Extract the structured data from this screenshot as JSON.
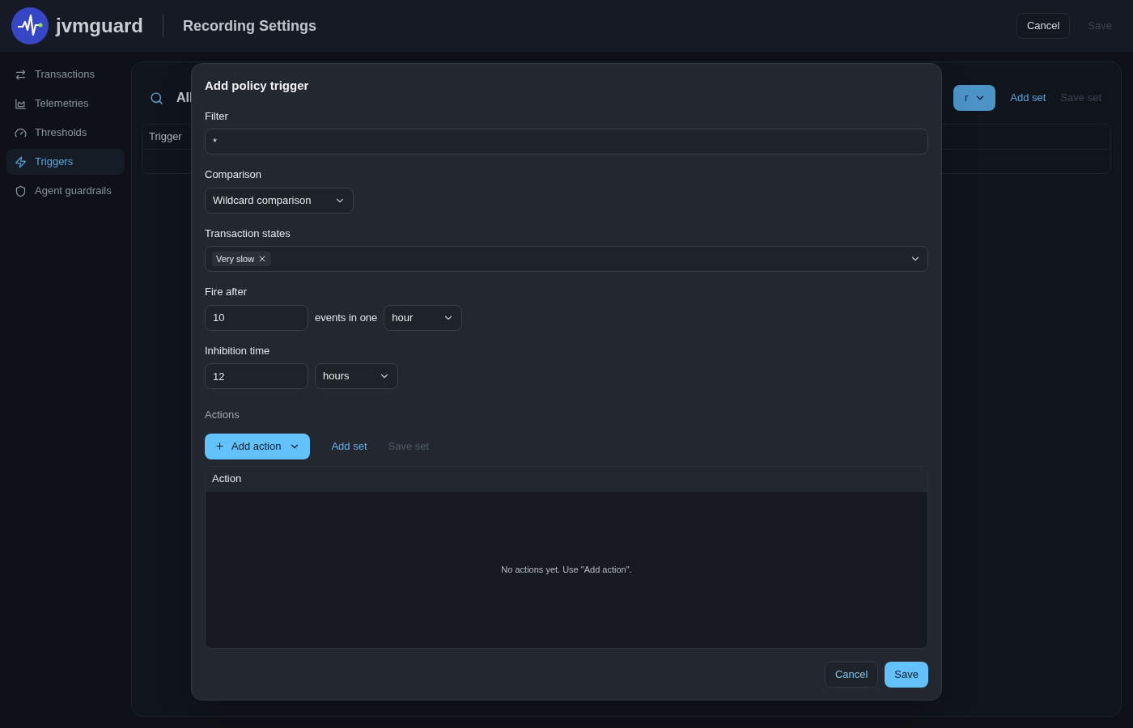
{
  "header": {
    "brand": "jvmguard",
    "title": "Recording Settings",
    "buttons": [
      {
        "label": "Cancel",
        "disabled": false
      },
      {
        "label": "Save",
        "disabled": true
      }
    ]
  },
  "sidebar": {
    "items": [
      {
        "label": "Transactions",
        "kind": "arrows",
        "selected": false
      },
      {
        "label": "Telemetries",
        "kind": "chart",
        "selected": false
      },
      {
        "label": "Thresholds",
        "kind": "gauge",
        "selected": false
      },
      {
        "label": "Triggers",
        "kind": "bolt",
        "selected": true
      },
      {
        "label": "Agent guardrails",
        "kind": "shield",
        "selected": false
      }
    ]
  },
  "main": {
    "search_label": "All",
    "primary_button": "r",
    "links": [
      {
        "label": "Add set",
        "disabled": false
      },
      {
        "label": "Save set",
        "disabled": true
      }
    ],
    "table": {
      "columns": [
        "Trigger"
      ]
    }
  },
  "dialog": {
    "title": "Add policy trigger",
    "filter": {
      "label": "Filter",
      "value": "*"
    },
    "comparison": {
      "label": "Comparison",
      "value": "Wildcard comparison"
    },
    "transaction_states": {
      "label": "Transaction states",
      "tags": [
        "Very slow"
      ]
    },
    "fire_after": {
      "label": "Fire after",
      "value": "10",
      "text": "events in one",
      "unit": "hour"
    },
    "inhibition_time": {
      "label": "Inhibition time",
      "value": "12",
      "unit": "hours"
    },
    "actions": {
      "label": "Actions",
      "add_button": "Add action",
      "links": [
        {
          "label": "Add set",
          "disabled": false
        },
        {
          "label": "Save set",
          "disabled": true
        }
      ],
      "table": {
        "columns": [
          "Action"
        ],
        "empty": "No actions yet. Use \"Add action\"."
      }
    },
    "buttons": [
      {
        "label": "Cancel",
        "kind": "secondary"
      },
      {
        "label": "Save",
        "kind": "primary"
      }
    ]
  }
}
